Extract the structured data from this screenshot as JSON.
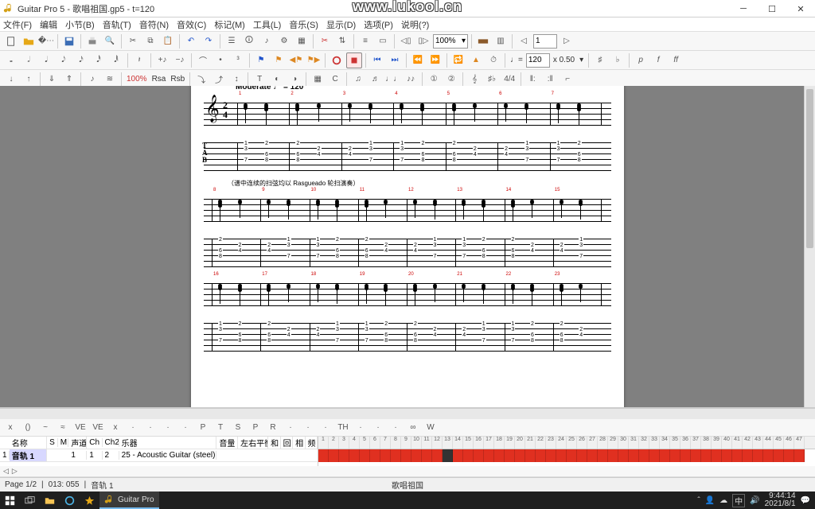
{
  "window": {
    "title": "Guitar Pro 5 - 歌唱祖国.gp5 - t=120",
    "watermark": "www.lukool.cn"
  },
  "menu": {
    "items": [
      "文件(F)",
      "编辑",
      "小节(B)",
      "音轨(T)",
      "音符(N)",
      "音效(C)",
      "标记(M)",
      "工具(L)",
      "音乐(S)",
      "显示(D)",
      "选项(P)",
      "说明(?)"
    ]
  },
  "toolbar1": {
    "zoom": "100%",
    "page_spin": "1"
  },
  "toolbar2": {
    "tempo_val": "120",
    "tempo_mult": "x 0.50"
  },
  "toolbar3": {
    "percent": "100%",
    "rsa": "Rsa",
    "rsb": "Rsb"
  },
  "score": {
    "tempo_text": "Moderate",
    "tempo_bpm": "= 120",
    "annotation": "（谱中连续的扫弦均以 Rasgueado 轮扫演奏）",
    "systems": [
      {
        "measures": [
          1,
          2,
          3,
          4,
          5,
          6,
          7
        ],
        "has_clef": true
      },
      {
        "measures": [
          8,
          9,
          10,
          11,
          12,
          13,
          14,
          15
        ],
        "has_clef": false
      },
      {
        "measures": [
          16,
          17,
          18,
          19,
          20,
          21,
          22,
          23
        ],
        "has_clef": false
      }
    ]
  },
  "note_panel": {
    "items": [
      "x",
      "()",
      "~",
      "≈",
      "VE",
      "VE",
      "x",
      "",
      "",
      "",
      "",
      "P",
      "T",
      "S",
      "P",
      "R",
      "",
      "",
      "",
      "TH",
      "",
      "",
      "",
      "∞",
      "W"
    ]
  },
  "track_table": {
    "headers": [
      "",
      "名称",
      "S",
      "M",
      "声道",
      "Ch",
      "Ch2",
      "乐器",
      "音量",
      "左右平衡",
      "和",
      "回",
      "相",
      "频"
    ],
    "row": {
      "num": "1",
      "name": "音轨 1",
      "s": "",
      "m": "",
      "port": "1",
      "ch": "1",
      "ch2": "2",
      "instrument": "25 - Acoustic Guitar (steel)",
      "vol": "",
      "pan": "",
      "cho": "",
      "rev": "",
      "pha": "",
      "tre": ""
    },
    "measure_count": 47,
    "cursor_at": 13
  },
  "status": {
    "page": "Page 1/2",
    "pos": "013: 055",
    "track": "音轨 1",
    "song": "歌唱祖国"
  },
  "taskbar": {
    "app_label": "Guitar Pro",
    "ime": "中",
    "time": "9:44:14",
    "date": "2021/8/1"
  }
}
